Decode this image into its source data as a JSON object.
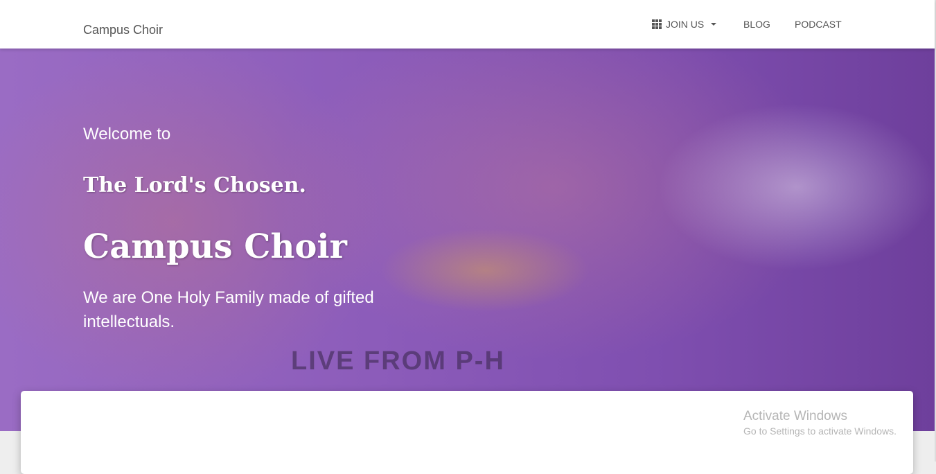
{
  "nav": {
    "brand": "Campus Choir",
    "items": [
      {
        "label": "JOIN US",
        "icon": "apps-grid-icon",
        "dropdown": true
      },
      {
        "label": "BLOG"
      },
      {
        "label": "PODCAST"
      }
    ]
  },
  "hero": {
    "welcome": "Welcome to",
    "subtitle": "The Lord's Chosen.",
    "title": "Campus Choir",
    "tagline_pre": "We are ",
    "tagline_bold": "One Holy Family",
    "tagline_post": " made of gifted intellectuals.",
    "banner_text": "LIVE FROM  P-H"
  },
  "watermark": {
    "line1": "Activate Windows",
    "line2": "Go to Settings to activate Windows."
  }
}
